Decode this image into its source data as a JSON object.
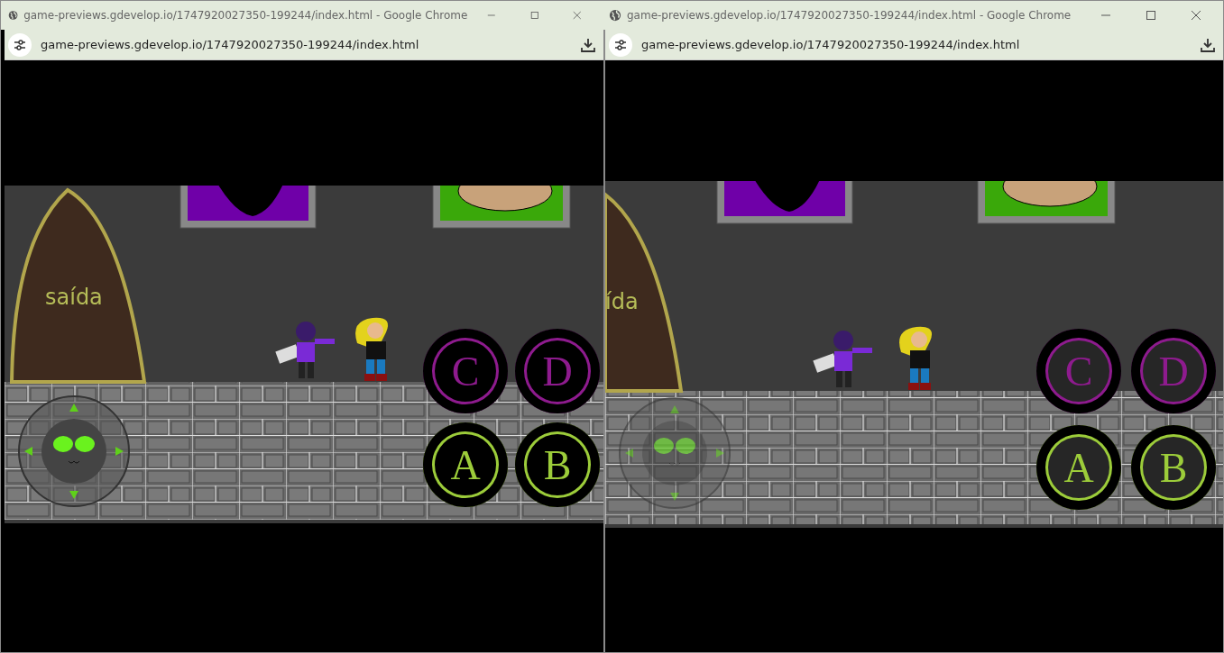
{
  "windows": [
    {
      "title": "game-previews.gdevelop.io/1747920027350-199244/index.html - Google Chrome",
      "url": "game-previews.gdevelop.io/1747920027350-199244/index.html",
      "game": {
        "door_sign": "saída",
        "controls_faded": false,
        "buttons": [
          {
            "label": "C",
            "color": "#8e1b8e"
          },
          {
            "label": "D",
            "color": "#8e1b8e"
          },
          {
            "label": "A",
            "color": "#9ccc3a"
          },
          {
            "label": "B",
            "color": "#9ccc3a"
          }
        ]
      }
    },
    {
      "title": "game-previews.gdevelop.io/1747920027350-199244/index.html - Google Chrome",
      "url": "game-previews.gdevelop.io/1747920027350-199244/index.html",
      "game": {
        "door_sign": "ída",
        "controls_faded": true,
        "buttons": [
          {
            "label": "C",
            "color": "#8e1b8e"
          },
          {
            "label": "D",
            "color": "#8e1b8e"
          },
          {
            "label": "A",
            "color": "#9ccc3a"
          },
          {
            "label": "B",
            "color": "#9ccc3a"
          }
        ]
      }
    }
  ]
}
